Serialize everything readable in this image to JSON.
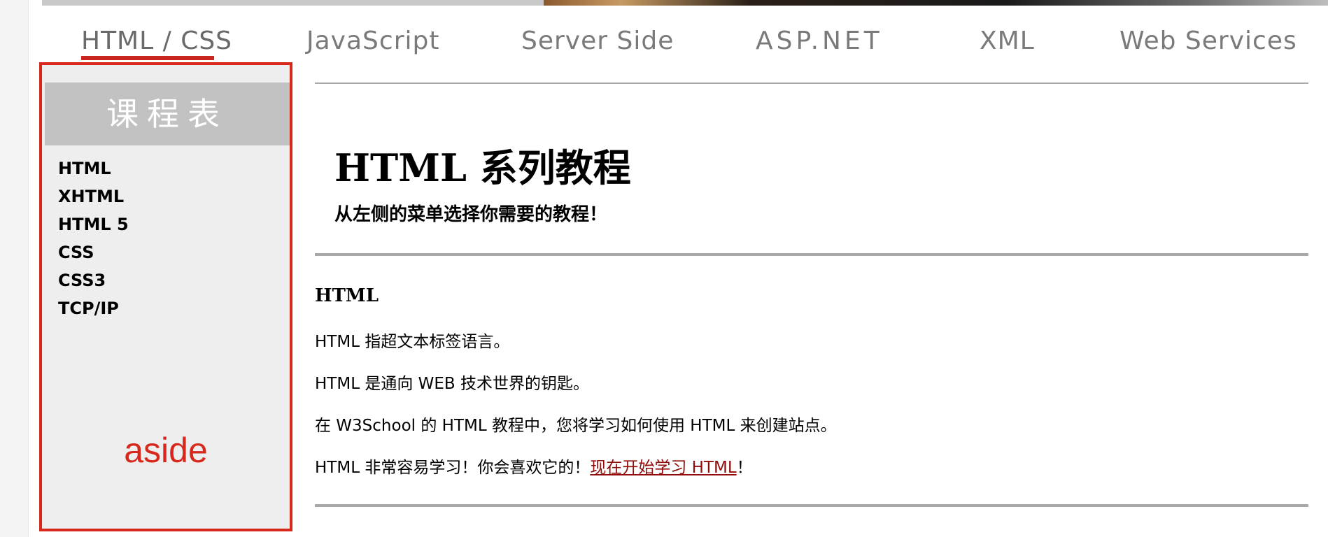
{
  "nav": {
    "items": [
      {
        "label": "HTML / CSS",
        "active": true
      },
      {
        "label": "JavaScript",
        "active": false
      },
      {
        "label": "Server Side",
        "active": false
      },
      {
        "label": "ASP.NET",
        "active": false
      },
      {
        "label": "XML",
        "active": false
      },
      {
        "label": "Web Services",
        "active": false
      }
    ]
  },
  "aside": {
    "title": "课程表",
    "items": [
      "HTML",
      "XHTML",
      "HTML 5",
      "CSS",
      "CSS3",
      "TCP/IP"
    ],
    "annotation": "aside"
  },
  "main": {
    "title": "HTML 系列教程",
    "subtitle": "从左侧的菜单选择你需要的教程！",
    "section_title": "HTML",
    "paragraphs": [
      "HTML 指超文本标签语言。",
      "HTML 是通向 WEB 技术世界的钥匙。",
      "在 W3School 的 HTML 教程中，您将学习如何使用 HTML 来创建站点。"
    ],
    "last_paragraph": {
      "prefix": "HTML 非常容易学习！你会喜欢它的！",
      "link": "现在开始学习 HTML",
      "suffix": "！"
    }
  },
  "colors": {
    "accent_red": "#d8281c",
    "link": "#900b09",
    "aside_bg": "#eeeeee",
    "aside_header_bg": "#c2c2c2",
    "nav_text": "#7a7a7a"
  }
}
